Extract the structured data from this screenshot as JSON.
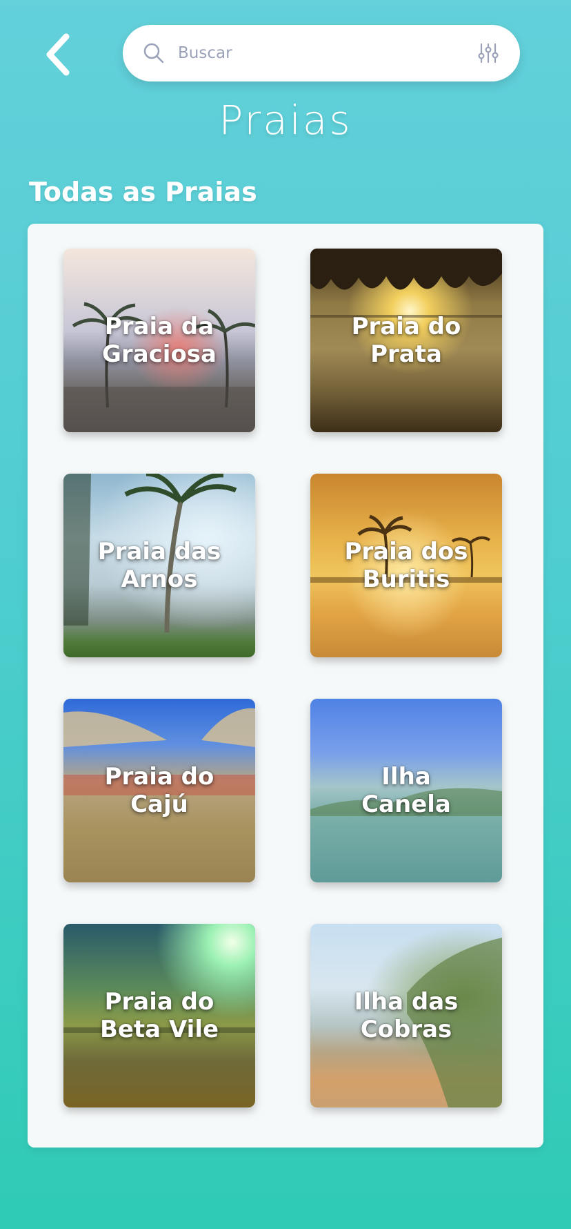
{
  "header": {
    "back_icon": "chevron-left-icon",
    "search": {
      "placeholder": "Buscar",
      "value": "",
      "icon": "search-icon",
      "filter_icon": "sliders-icon"
    }
  },
  "page": {
    "title": "Praias",
    "section_title": "Todas as Praias"
  },
  "beaches": [
    {
      "name": "Praia da\nGraciosa"
    },
    {
      "name": "Praia do\nPrata"
    },
    {
      "name": "Praia das\nArnos"
    },
    {
      "name": "Praia dos\nBuritis"
    },
    {
      "name": "Praia do\nCajú"
    },
    {
      "name": "Ilha\nCanela"
    },
    {
      "name": "Praia do\nBeta Vile"
    },
    {
      "name": "Ilha das\nCobras"
    }
  ],
  "colors": {
    "background_top": "#63d0da",
    "background_bottom": "#2fcbb5",
    "panel": "#f6f9f9",
    "text_light": "#ffffff",
    "placeholder": "#9aa1b8"
  }
}
